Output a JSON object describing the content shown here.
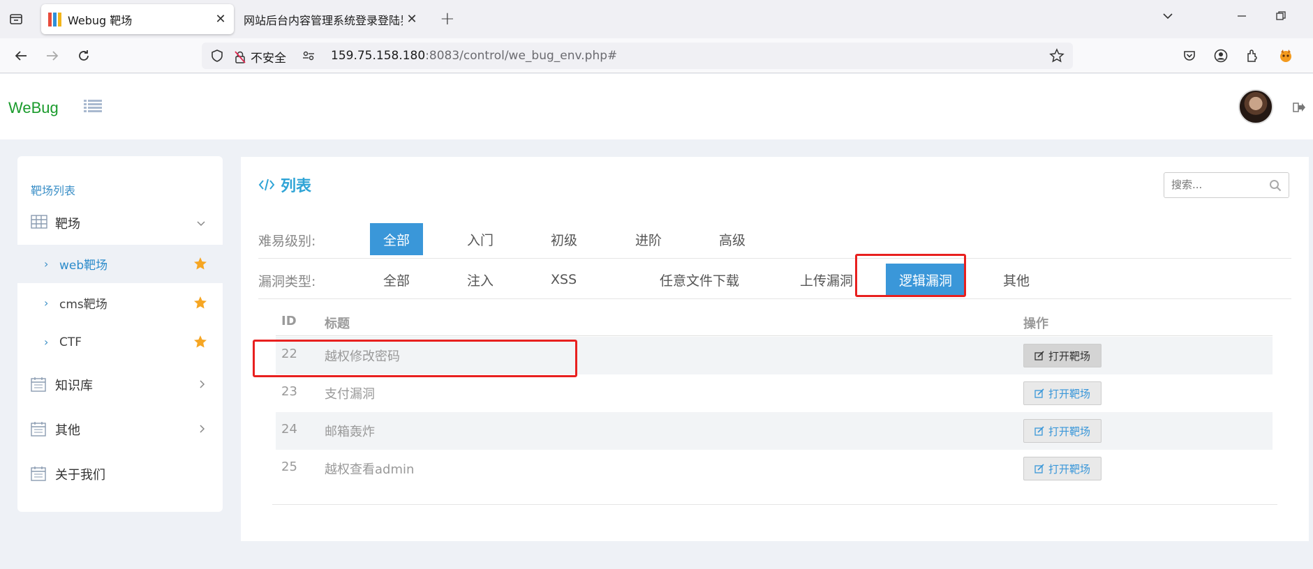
{
  "browser": {
    "tabs": [
      {
        "title": "Webug 靶场",
        "active": true
      },
      {
        "title": "网站后台内容管理系统登录登陆界面",
        "active": false
      }
    ],
    "url_security_label": "不安全",
    "url_host": "159.75.158.180",
    "url_rest": ":8083/control/we_bug_env.php#"
  },
  "header": {
    "logo": "WeBug"
  },
  "sidebar": {
    "heading": "靶场列表",
    "group_label": "靶场",
    "sub_items": [
      {
        "label": "web靶场",
        "active": true
      },
      {
        "label": "cms靶场",
        "active": false
      },
      {
        "label": "CTF",
        "active": false
      }
    ],
    "items": [
      {
        "label": "知识库"
      },
      {
        "label": "其他"
      },
      {
        "label": "关于我们"
      }
    ]
  },
  "main": {
    "title": "列表",
    "search_placeholder": "搜索...",
    "difficulty": {
      "label": "难易级别:",
      "options": [
        "全部",
        "入门",
        "初级",
        "进阶",
        "高级"
      ],
      "selected": 0
    },
    "vuln_type": {
      "label": "漏洞类型:",
      "options": [
        "全部",
        "注入",
        "XSS",
        "任意文件下载",
        "上传漏洞",
        "逻辑漏洞",
        "其他"
      ],
      "selected": 5
    },
    "table": {
      "headers": {
        "id": "ID",
        "title": "标题",
        "action": "操作"
      },
      "rows": [
        {
          "id": "22",
          "title": "越权修改密码",
          "action": "打开靶场"
        },
        {
          "id": "23",
          "title": "支付漏洞",
          "action": "打开靶场"
        },
        {
          "id": "24",
          "title": "邮箱轰炸",
          "action": "打开靶场"
        },
        {
          "id": "25",
          "title": "越权查看admin",
          "action": "打开靶场"
        }
      ]
    }
  },
  "colors": {
    "accent": "#3a97d9",
    "logo": "#1a9b2c",
    "highlight": "#e8201f"
  }
}
